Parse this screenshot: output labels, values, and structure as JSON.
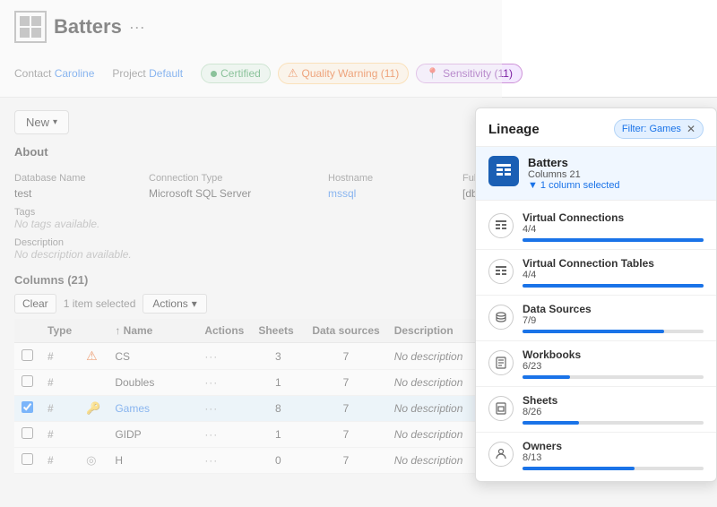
{
  "header": {
    "title": "Batters",
    "more_label": "···",
    "contact_label": "Contact",
    "contact_value": "Caroline",
    "project_label": "Project",
    "project_value": "Default"
  },
  "badges": [
    {
      "id": "certified",
      "label": "Certified",
      "type": "certified"
    },
    {
      "id": "quality",
      "label": "Quality Warning (11)",
      "type": "quality"
    },
    {
      "id": "sensitivity",
      "label": "Sensitivity (11)",
      "type": "sensitivity"
    }
  ],
  "new_button": "New",
  "about": {
    "title": "About",
    "fields": [
      {
        "label": "Database Name",
        "value": "test",
        "link": false
      },
      {
        "label": "Connection Type",
        "value": "Microsoft SQL Server",
        "link": false
      },
      {
        "label": "Hostname",
        "value": "mssql",
        "link": true
      },
      {
        "label": "Full Name",
        "value": "[dbo].[Batters]",
        "link": false
      }
    ],
    "tags_label": "Tags",
    "tags_value": "No tags available.",
    "desc_label": "Description",
    "desc_value": "No description available."
  },
  "columns": {
    "title": "Columns (21)",
    "toolbar": {
      "clear_label": "Clear",
      "selected_text": "1 item selected",
      "actions_label": "Actions"
    },
    "headers": [
      "Type",
      "",
      "↑ Name",
      "Actions",
      "Sheets",
      "Data sources",
      "Description"
    ],
    "rows": [
      {
        "checked": false,
        "type": "#",
        "warn": "warn",
        "name": "CS",
        "name_link": false,
        "dots": "···",
        "sheets": "3",
        "datasources": "7",
        "desc": "No description"
      },
      {
        "checked": false,
        "type": "#",
        "warn": "",
        "name": "Doubles",
        "name_link": false,
        "dots": "···",
        "sheets": "1",
        "datasources": "7",
        "desc": "No description"
      },
      {
        "checked": true,
        "type": "#",
        "warn": "key",
        "name": "Games",
        "name_link": true,
        "dots": "···",
        "sheets": "8",
        "datasources": "7",
        "desc": "No description"
      },
      {
        "checked": false,
        "type": "#",
        "warn": "",
        "name": "GIDP",
        "name_link": false,
        "dots": "···",
        "sheets": "1",
        "datasources": "7",
        "desc": "No description"
      },
      {
        "checked": false,
        "type": "#",
        "warn": "geo",
        "name": "H",
        "name_link": false,
        "dots": "···",
        "sheets": "0",
        "datasources": "7",
        "desc": "No description"
      }
    ]
  },
  "lineage": {
    "title": "Lineage",
    "filter_label": "Filter: Games",
    "top": {
      "name": "Batters",
      "columns": "Columns 21",
      "selected": "1 column selected"
    },
    "items": [
      {
        "id": "virtual-connections",
        "name": "Virtual Connections",
        "count": "4/4",
        "bar_pct": 100,
        "icon": "vc"
      },
      {
        "id": "virtual-connection-tables",
        "name": "Virtual Connection Tables",
        "count": "4/4",
        "bar_pct": 100,
        "icon": "vct"
      },
      {
        "id": "data-sources",
        "name": "Data Sources",
        "count": "7/9",
        "bar_pct": 78,
        "icon": "ds"
      },
      {
        "id": "workbooks",
        "name": "Workbooks",
        "count": "6/23",
        "bar_pct": 26,
        "icon": "wb"
      },
      {
        "id": "sheets",
        "name": "Sheets",
        "count": "8/26",
        "bar_pct": 31,
        "icon": "sh"
      },
      {
        "id": "owners",
        "name": "Owners",
        "count": "8/13",
        "bar_pct": 62,
        "icon": "ow"
      }
    ]
  }
}
